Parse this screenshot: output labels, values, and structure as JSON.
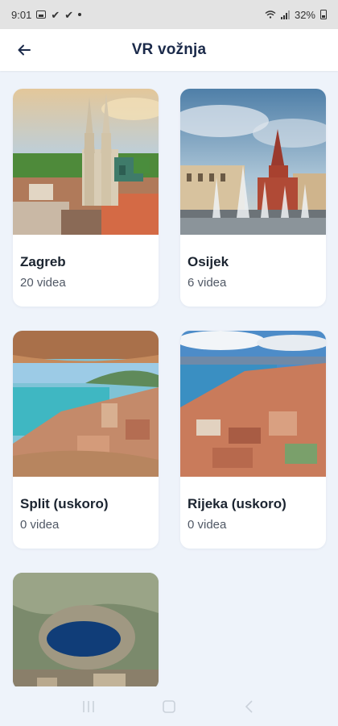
{
  "status_bar": {
    "time": "9:01",
    "battery": "32%"
  },
  "header": {
    "title": "VR vožnja"
  },
  "cards": [
    {
      "title": "Zagreb",
      "subtitle": "20 videa",
      "image": "zagreb-cathedral-photo"
    },
    {
      "title": "Osijek",
      "subtitle": "6 videa",
      "image": "osijek-fountain-church-photo"
    },
    {
      "title": "Split (uskoro)",
      "subtitle": "0 videa",
      "image": "split-harbor-aerial-photo"
    },
    {
      "title": "Rijeka (uskoro)",
      "subtitle": "0 videa",
      "image": "rijeka-city-aerial-photo"
    },
    {
      "title": "",
      "subtitle": "",
      "image": "blue-lake-imotski-aerial-photo"
    }
  ],
  "colors": {
    "background": "#eef3fa",
    "card": "#ffffff",
    "title": "#1b2a4a"
  },
  "nav_icons": [
    "recents-icon",
    "home-icon",
    "back-icon"
  ]
}
